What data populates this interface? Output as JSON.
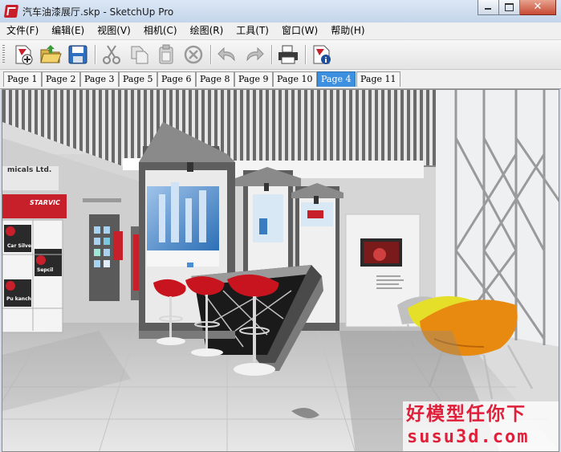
{
  "window": {
    "title": "汽车油漆展厅.skp - SketchUp Pro",
    "app_icon": "sketchup-icon",
    "controls": {
      "minimize": "minimize-icon",
      "maximize": "maximize-icon",
      "close": "✕"
    }
  },
  "menu": {
    "items": [
      {
        "label": "文件(F)"
      },
      {
        "label": "编辑(E)"
      },
      {
        "label": "视图(V)"
      },
      {
        "label": "相机(C)"
      },
      {
        "label": "绘图(R)"
      },
      {
        "label": "工具(T)"
      },
      {
        "label": "窗口(W)"
      },
      {
        "label": "帮助(H)"
      }
    ]
  },
  "toolbar": {
    "buttons": [
      {
        "icon": "new-file-icon"
      },
      {
        "icon": "open-folder-icon"
      },
      {
        "icon": "save-icon"
      },
      {
        "icon": "cut-icon"
      },
      {
        "icon": "copy-icon"
      },
      {
        "icon": "paste-icon"
      },
      {
        "icon": "erase-icon"
      },
      {
        "icon": "undo-icon"
      },
      {
        "icon": "redo-icon"
      },
      {
        "icon": "print-icon"
      },
      {
        "icon": "model-info-icon"
      }
    ]
  },
  "scene_tabs": {
    "active": "Page 4",
    "tabs": [
      {
        "label": "Page 1"
      },
      {
        "label": "Page 2"
      },
      {
        "label": "Page 3"
      },
      {
        "label": "Page 5"
      },
      {
        "label": "Page 6"
      },
      {
        "label": "Page 8"
      },
      {
        "label": "Page 9"
      },
      {
        "label": "Page 10"
      },
      {
        "label": "Page 4"
      },
      {
        "label": "Page 11"
      }
    ]
  },
  "viewport": {
    "signage": {
      "company": "micals Ltd.",
      "brand": "STARVIC",
      "panel_1": "Car Silver",
      "panel_4": "Sepcil",
      "panel_5": "Pu kanch"
    }
  },
  "watermark": {
    "line1": "好模型任你下",
    "line2": "susu3d.com"
  },
  "colors": {
    "active_tab": "#3d8fe0",
    "stool_red": "#c8141e",
    "chair_orange": "#e98a10",
    "chair_yellow": "#e6df2a",
    "brand_red": "#c8202a",
    "watermark_red": "#e0203a"
  }
}
